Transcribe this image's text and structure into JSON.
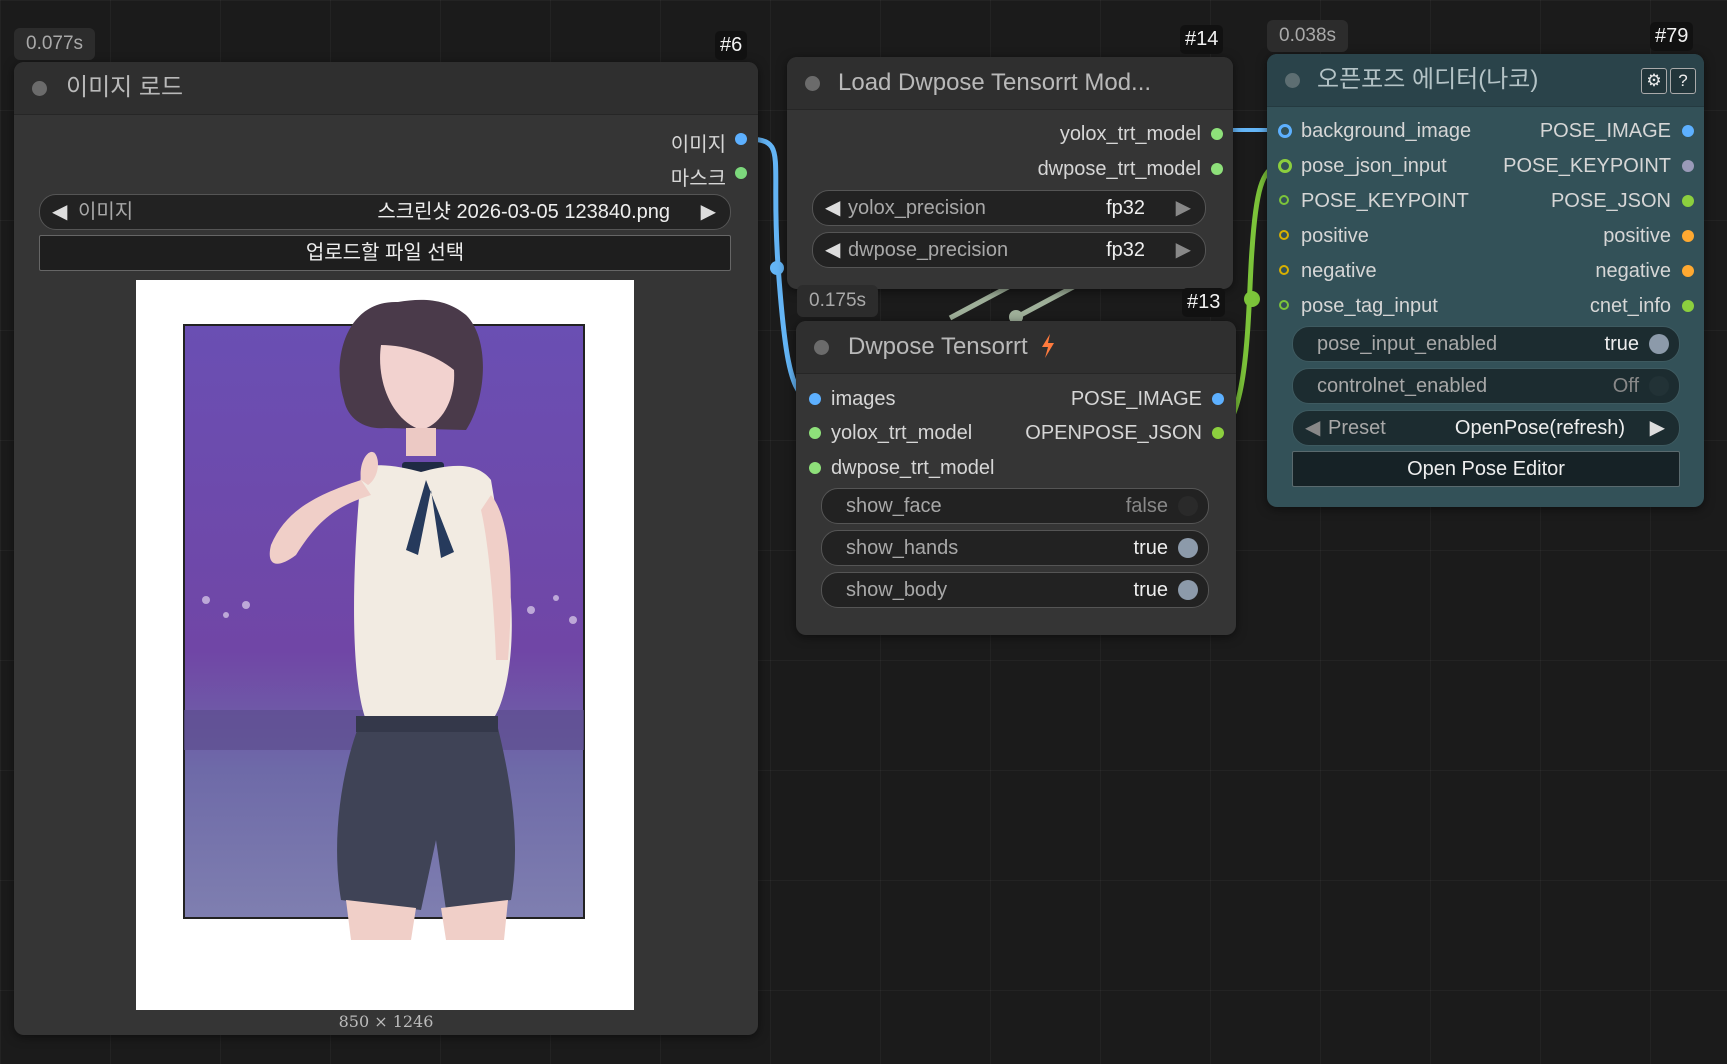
{
  "nodes": {
    "load_image": {
      "timing": "0.077s",
      "id": "#6",
      "title": "이미지 로드",
      "outputs": [
        "이미지",
        "마스크"
      ],
      "image_combo": {
        "label": "이미지",
        "value": "스크린샷 2026-03-05 123840.png"
      },
      "upload_button": "업로드할 파일 선택",
      "image_size": "850 × 1246"
    },
    "load_dwpose": {
      "id": "#14",
      "title": "Load Dwpose Tensorrt Mod...",
      "outputs": [
        "yolox_trt_model",
        "dwpose_trt_model"
      ],
      "widgets": [
        {
          "label": "yolox_precision",
          "value": "fp32"
        },
        {
          "label": "dwpose_precision",
          "value": "fp32"
        }
      ]
    },
    "dwpose": {
      "timing": "0.175s",
      "id": "#13",
      "title": "Dwpose Tensorrt",
      "inputs": [
        "images",
        "yolox_trt_model",
        "dwpose_trt_model"
      ],
      "outputs": [
        "POSE_IMAGE",
        "OPENPOSE_JSON"
      ],
      "toggles": [
        {
          "label": "show_face",
          "value": "false",
          "on": false
        },
        {
          "label": "show_hands",
          "value": "true",
          "on": true
        },
        {
          "label": "show_body",
          "value": "true",
          "on": true
        }
      ]
    },
    "openpose_editor": {
      "timing": "0.038s",
      "id": "#79",
      "title": "오픈포즈 에디터(나코)",
      "settings_icon": "⚙",
      "help_icon": "?",
      "inputs": [
        "background_image",
        "pose_json_input",
        "POSE_KEYPOINT",
        "positive",
        "negative",
        "pose_tag_input"
      ],
      "outputs": [
        "POSE_IMAGE",
        "POSE_KEYPOINT",
        "POSE_JSON",
        "positive",
        "negative",
        "cnet_info"
      ],
      "toggles": [
        {
          "label": "pose_input_enabled",
          "value": "true",
          "on": true
        },
        {
          "label": "controlnet_enabled",
          "value": "Off",
          "on": false
        }
      ],
      "preset": {
        "label": "Preset",
        "value": "OpenPose(refresh)"
      },
      "open_button": "Open Pose Editor"
    }
  },
  "colors": {
    "image_slot": "#5db0ff",
    "mask_slot": "#7cd87c",
    "model_slot": "#8ee07a",
    "json_slot": "#8ccf3e",
    "conditioning_slot": "#ffa931",
    "keypoint_slot": "#9a9ab8",
    "wire_image": "#64b5f6",
    "wire_json": "#7cc43a",
    "wire_model": "#9fb09a",
    "lightning": "#ff7a3d"
  }
}
